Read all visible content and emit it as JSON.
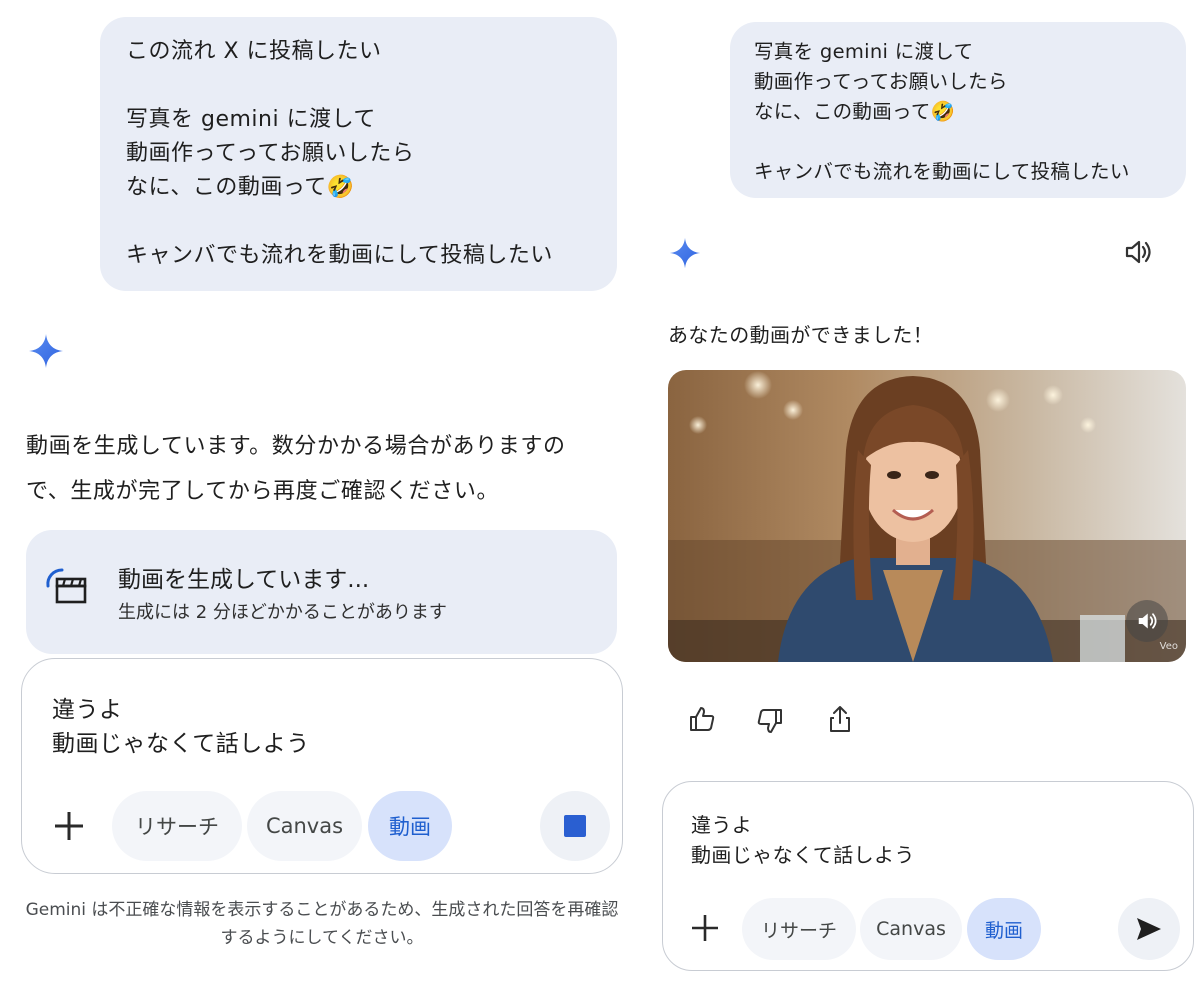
{
  "left": {
    "user_message": {
      "lines": [
        "この流れ X に投稿したい",
        "",
        "写真を gemini に渡して",
        "動画作ってってお願いしたら",
        "なに、この動画って🤣",
        "",
        "キャンバでも流れを動画にして投稿したい"
      ]
    },
    "ai_message": {
      "lines": [
        "動画を生成しています。数分かかる場合がありますの",
        "で、生成が完了してから再度ご確認ください。"
      ]
    },
    "generating_card": {
      "title": "動画を生成しています...",
      "subtitle": "生成には 2 分ほどかかることがあります",
      "icon": "clapperboard-loading-icon"
    },
    "composer": {
      "text_lines": [
        "違うよ",
        "動画じゃなくて話しよう"
      ],
      "chips": [
        "リサーチ",
        "Canvas",
        "動画"
      ],
      "active_chip": "動画",
      "add_icon": "plus-icon",
      "action_icon": "stop-icon"
    },
    "disclaimer": "Gemini は不正確な情報を表示することがあるため、生成された回答を再確認するようにしてください。"
  },
  "right": {
    "user_message": {
      "lines": [
        "写真を gemini に渡して",
        "動画作ってってお願いしたら",
        "なに、この動画って🤣",
        "",
        "キャンバでも流れを動画にして投稿したい"
      ]
    },
    "ai_message": "あなたの動画ができました！",
    "video": {
      "watermark": "Veo",
      "volume_icon": "volume-icon"
    },
    "feedback_icons": [
      "thumbs-up-icon",
      "thumbs-down-icon",
      "share-icon"
    ],
    "read_aloud_icon": "speaker-icon",
    "composer": {
      "text_lines": [
        "違うよ",
        "動画じゃなくて話しよう"
      ],
      "chips": [
        "リサーチ",
        "Canvas",
        "動画"
      ],
      "active_chip": "動画",
      "add_icon": "plus-icon",
      "action_icon": "send-icon"
    }
  },
  "colors": {
    "bubble": "#e9edf6",
    "accent": "#1f5fcf",
    "active_chip": "#d7e2fb",
    "sparkle": "#3b74e8"
  }
}
